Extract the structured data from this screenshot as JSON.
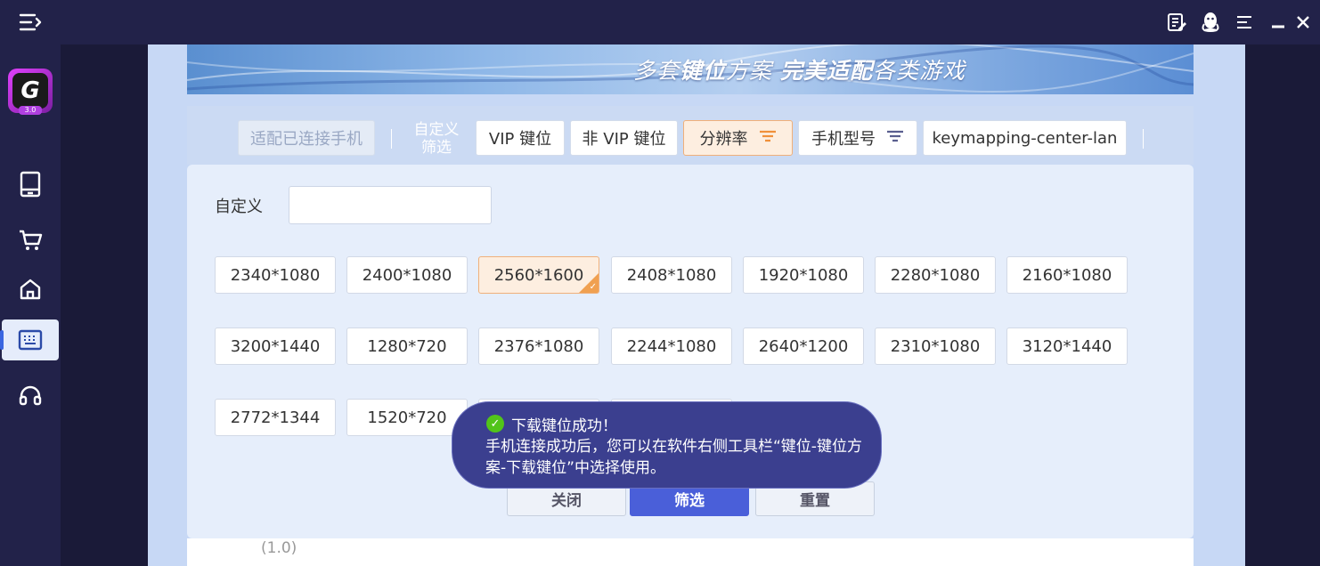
{
  "topbar": {
    "icons": [
      "menu-icon",
      "notes-icon",
      "qq-icon",
      "hamburger-icon",
      "minimize-icon",
      "close-icon"
    ]
  },
  "sidebar": {
    "logo_version": "3.0",
    "logo_letter": "G",
    "items": [
      {
        "name": "device",
        "icon": "tablet-icon"
      },
      {
        "name": "store",
        "icon": "cart-icon"
      },
      {
        "name": "home",
        "icon": "home-icon"
      },
      {
        "name": "keymapping",
        "icon": "keyboard-icon",
        "active": true
      },
      {
        "name": "support",
        "icon": "headset-icon"
      }
    ]
  },
  "banner": {
    "slogan_part1": "多套",
    "slogan_part2": "键位",
    "slogan_part3": "方案  ",
    "slogan_part4": "完美适配",
    "slogan_part5": "各类游戏"
  },
  "filterbar": {
    "fit_connected": "适配已连接手机",
    "custom_filter": "自定义\n筛选",
    "vip": "VIP 键位",
    "non_vip": "非 VIP 键位",
    "resolution": "分辨率",
    "phone_model": "手机型号",
    "keymapping_center": "keymapping-center-lan"
  },
  "dropdown": {
    "custom_label": "自定义",
    "custom_value": "",
    "resolutions": [
      [
        "2340*1080",
        "2400*1080",
        "2560*1600",
        "2408*1080",
        "1920*1080",
        "2280*1080",
        "2160*1080"
      ],
      [
        "3200*1440",
        "1280*720",
        "2376*1080",
        "2244*1080",
        "2640*1200",
        "2310*1080",
        "3120*1440"
      ],
      [
        "2772*1344",
        "1520*720",
        "",
        ""
      ]
    ],
    "selected": "2560*1600",
    "close": "关闭",
    "filter": "筛选",
    "reset": "重置"
  },
  "version": "(1.0)",
  "toast": {
    "title": "下载键位成功！",
    "message": "手机连接成功后，您可以在软件右侧工具栏“键位-键位方案-下载键位”中选择使用。"
  },
  "colors": {
    "accent": "#4a5fd9",
    "selected_bg": "#fdeee0",
    "selected_border": "#f0b07a",
    "sidebar_bg": "#222249",
    "success": "#52c41a"
  }
}
